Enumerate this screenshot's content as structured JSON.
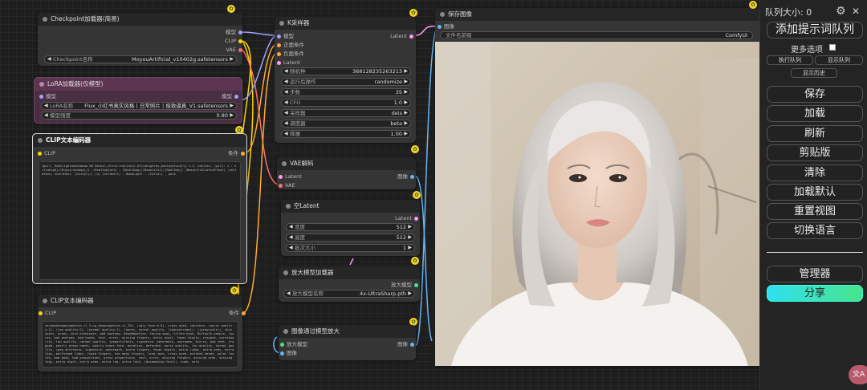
{
  "nodes": {
    "checkpoint": {
      "title": "Checkpoint加载器(简易)",
      "outputs": [
        "模型",
        "CLIP",
        "VAE"
      ],
      "ckpt_label": "Checkpoint名称",
      "ckpt_value": "MoyouArtificial_v10402g.safetensors"
    },
    "lora": {
      "title": "LoRA加载器(仅模型)",
      "input": "模型",
      "output": "模型",
      "lora_label": "LoRA名称",
      "lora_value": "Flux_小红书真实风格丨日常照片丨极致逼真_V1.safetensors",
      "strength_label": "模型强度",
      "strength_value": "0.80"
    },
    "clip_pos": {
      "title": "CLIP文本编码器",
      "input": "CLIP",
      "output": "条件",
      "text": "1girl, RealLightandshadow 8K Detail,Ultra-realistic,Ultrahighres,Achievetically 1.5, anklets, (girl: 1 : ultrahigh)/(Ruysirshadow)/1 -(RealSubject) - (RealImag)/(Beautiful)/(RealSub)/ (BeautifulLaclhefface) ,solidfoce, shortHair, (Ucityl)/( (u) (chrdvelt) - NoseLayer - (collar) , pale"
    },
    "clip_neg": {
      "title": "CLIP文本编码器",
      "input": "CLIP",
      "output": "条件",
      "text": "verybadimagenegative_v1.3,ng_deepnegative_v1_75t, (ugly face:0.8), cross-eyed, sketches, (worst quality:2), (low quality:2), (normal quality:2), lowres, normal quality, ((monochrome)), ((grayscale)), skin spots, acnes, skin blemishes, bad anatomy, DeepNegative, facing away, tilted head, Multiple people, lowres, bad anatomy, bad hands, text, error, missing fingers, extra digit, fewer digits, cropped, worstquality, low quality, normal quality, jpegartifacts, signature, watermark, username, blurry, bad feet, cropped, poorly drawn hands, poorly drawn face, mutation, deformed, worst quality, low quality, normal quality, jpeg artifacts, signature, watermark, extra fingers, fewer digits, extra limbs, extra arms, extra legs, malformed limbs, fused fingers, too many fingers, long neck, cross-eyed, mutated hands, polar lowres, bad body, bad proportions, gross proportions, text, error, missing fingers, missing arms, missing legs, extra digit, extra arms, extra leg, extra foot, (Unspeaking fault), nude, nsfw"
    },
    "ksampler": {
      "title": "K采样器",
      "inputs": [
        "模型",
        "正面条件",
        "负面条件",
        "Latent"
      ],
      "output": "Latent",
      "widgets": [
        {
          "label": "随机种",
          "value": "368128235263213"
        },
        {
          "label": "运行后操作",
          "value": "randomize"
        },
        {
          "label": "步数",
          "value": "35"
        },
        {
          "label": "CFG",
          "value": "1.0"
        },
        {
          "label": "采样器",
          "value": "deis"
        },
        {
          "label": "调度器",
          "value": "beta"
        },
        {
          "label": "降噪",
          "value": "1.00"
        }
      ]
    },
    "vae_decode": {
      "title": "VAE解码",
      "inputs": [
        "Latent",
        "VAE"
      ],
      "output": "图像"
    },
    "empty_latent": {
      "title": "空Latent",
      "output": "Latent",
      "widgets": [
        {
          "label": "宽度",
          "value": "512"
        },
        {
          "label": "高度",
          "value": "512"
        },
        {
          "label": "批次大小",
          "value": "1"
        }
      ]
    },
    "upscale_loader": {
      "title": "放大模型加载器",
      "output": "放大模型",
      "widget_label": "放大模型名称",
      "widget_value": "4x-UltraSharp.pth"
    },
    "upscale_image": {
      "title": "图像通过模型放大",
      "inputs": [
        "放大模型",
        "图像"
      ],
      "output": "图像"
    },
    "save_image": {
      "title": "保存图像",
      "input": "图像",
      "prefix_label": "文件名前缀",
      "prefix_value": "ComfyUI"
    }
  },
  "panel": {
    "queue_size": "队列大小: 0",
    "queue_prompt": "添加提示词队列",
    "extra_options": "更多选项",
    "run_queue": "执行队列",
    "view_queue": "显示队列",
    "view_history": "显示历史",
    "buttons": [
      "保存",
      "加载",
      "刷新",
      "剪贴版",
      "清除",
      "加载默认",
      "重置视图",
      "切换语言"
    ],
    "manager": "管理器",
    "share": "分享",
    "colors": {
      "share_gradient_start": "#2ee0f0",
      "share_gradient_end": "#49e48a",
      "lora_purple": "#5d3550"
    }
  },
  "corner_badge": "文A"
}
